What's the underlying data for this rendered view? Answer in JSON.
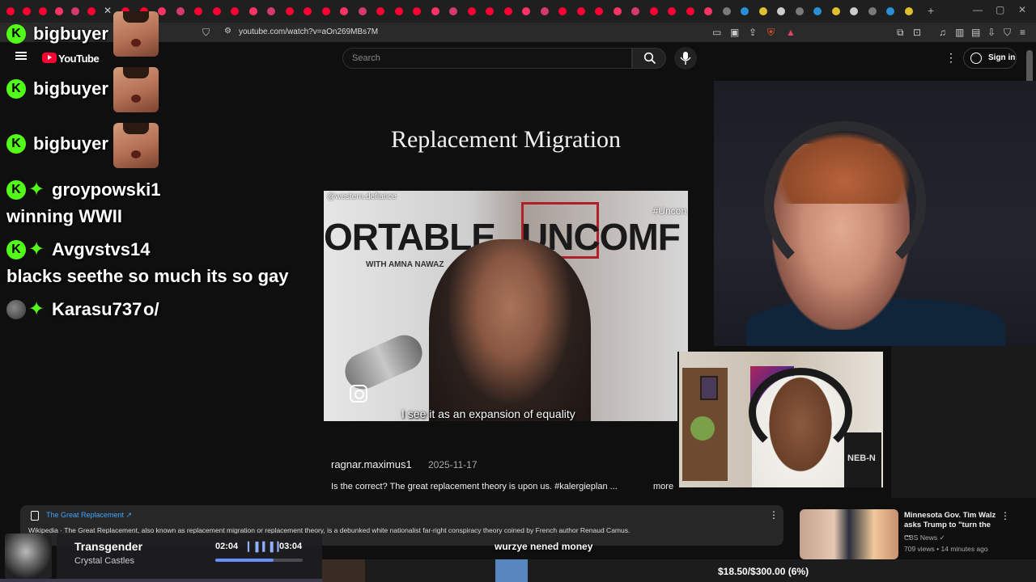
{
  "browser": {
    "url": "youtube.com/watch?v=aOn269MBs7M"
  },
  "youtube": {
    "logo_text": "YouTube",
    "search_placeholder": "Search",
    "sign_in_label": "Sign in",
    "more_label": "more"
  },
  "chat": {
    "messages": [
      {
        "user": "bigbuyer",
        "text": ""
      },
      {
        "user": "bigbuyer",
        "text": ""
      },
      {
        "user": "bigbuyer",
        "text": ""
      },
      {
        "user": "groypowski1",
        "text": "winning WWII"
      },
      {
        "user": "Avgvstvs14",
        "text": "blacks seethe so much its so gay"
      },
      {
        "user": "Karasu737",
        "text": "o/"
      }
    ]
  },
  "video": {
    "title": "Replacement Migration",
    "frame_handle": "@western.defiance",
    "frame_hashtag": "#Uncon",
    "frame_banner_left": "ORTABLE",
    "frame_banner_sub": "WITH AMNA NAWAZ",
    "frame_banner_right": "UNCOMF",
    "frame_caption": "I see it as an expansion of equality",
    "channel": "ragnar.maximus1",
    "date": "2025-11-17",
    "description": "Is the correct? The great replacement theory is upon us. #kalergieplan ..."
  },
  "guest_cam": {
    "chair_text": "NEB-N"
  },
  "info_card": {
    "title": "The Great Replacement ↗",
    "text": "Wikipedia · The Great Replacement, also known as replacement migration or replacement theory, is a debunked white nationalist far-right conspiracy theory coined by French author Renaud Camus."
  },
  "related": {
    "title": "Minnesota Gov. Tim Walz asks Trump to \"turn the ...",
    "channel": "CBS News ✓",
    "meta": "709 views • 14 minutes ago"
  },
  "music": {
    "title": "Transgender",
    "artist": "Crystal Castles",
    "elapsed": "02:04",
    "total": "03:04",
    "progress": 0.67
  },
  "tts": {
    "text": "wurzye nened money"
  },
  "donation": {
    "label": "$18.50/$300.00 (6%)",
    "progress": 0.06
  },
  "colors": {
    "kick_green": "#53fc18",
    "youtube_red": "#ff0033",
    "link_blue": "#3ea6ff"
  }
}
